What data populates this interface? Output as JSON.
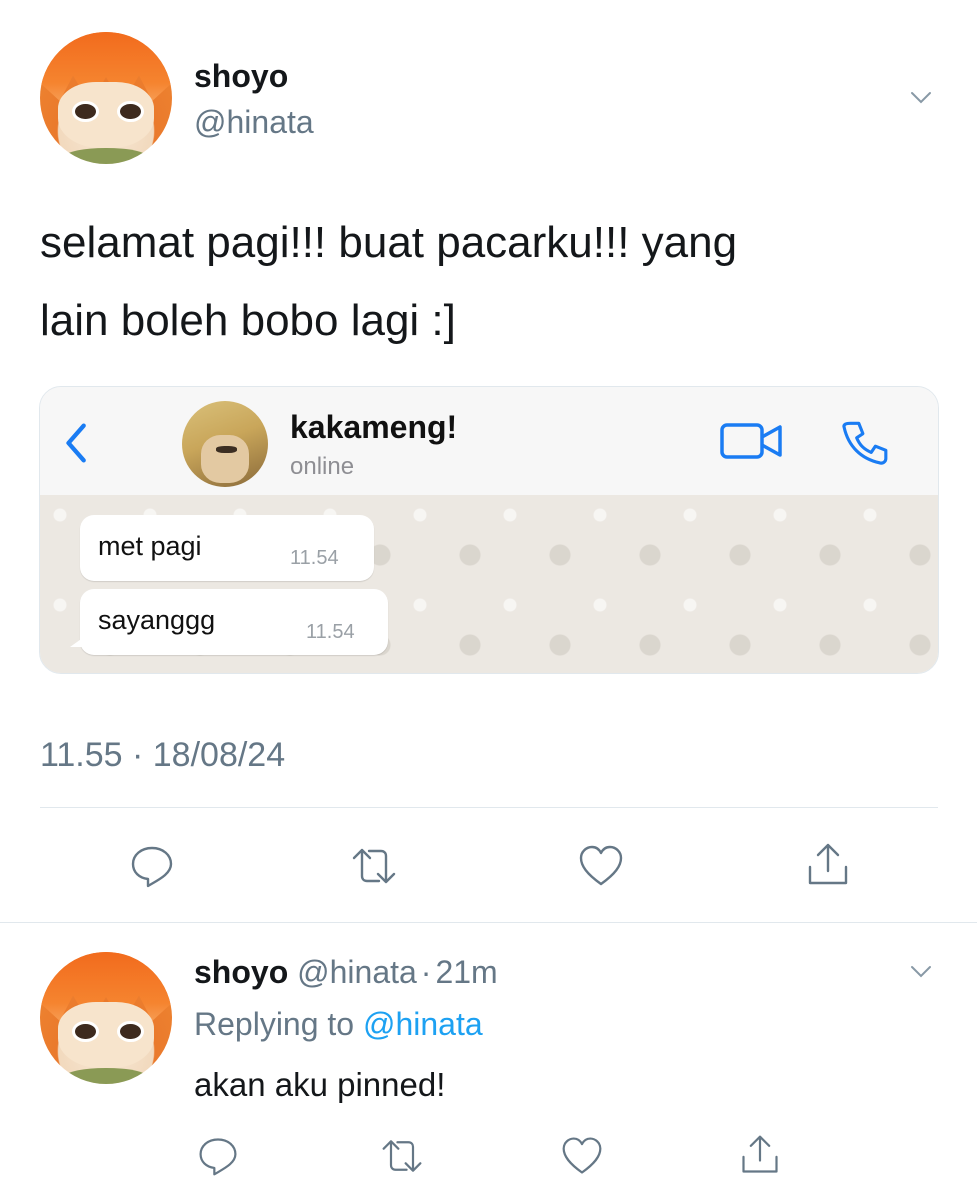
{
  "main_tweet": {
    "display_name": "shoyo",
    "handle": "@hinata",
    "text_line1": "selamat pagi!!! buat pacarku!!! yang",
    "text_line2": "lain boleh bobo lagi :]",
    "timestamp": "11.55 · 18/08/24",
    "icons": [
      "avatar",
      "chevron-down-icon",
      "reply-icon",
      "retweet-icon",
      "like-icon",
      "share-icon"
    ]
  },
  "whatsapp": {
    "contact_name": "kakameng!",
    "status": "online",
    "messages": [
      {
        "text": "met pagi",
        "time": "11.54"
      },
      {
        "text": "sayanggg",
        "time": "11.54"
      }
    ],
    "colors": {
      "accent": "#1a7cf3",
      "chat_bg": "#ece8e2"
    }
  },
  "reply_tweet": {
    "display_name": "shoyo",
    "handle": "@hinata",
    "separator": "·",
    "time_ago": "21m",
    "replying_prefix": "Replying to",
    "replying_handle": "@hinata",
    "text": "akan aku pinned!"
  },
  "colors": {
    "muted": "#657786",
    "link": "#1da1f2",
    "divider": "#e1e8ed"
  }
}
